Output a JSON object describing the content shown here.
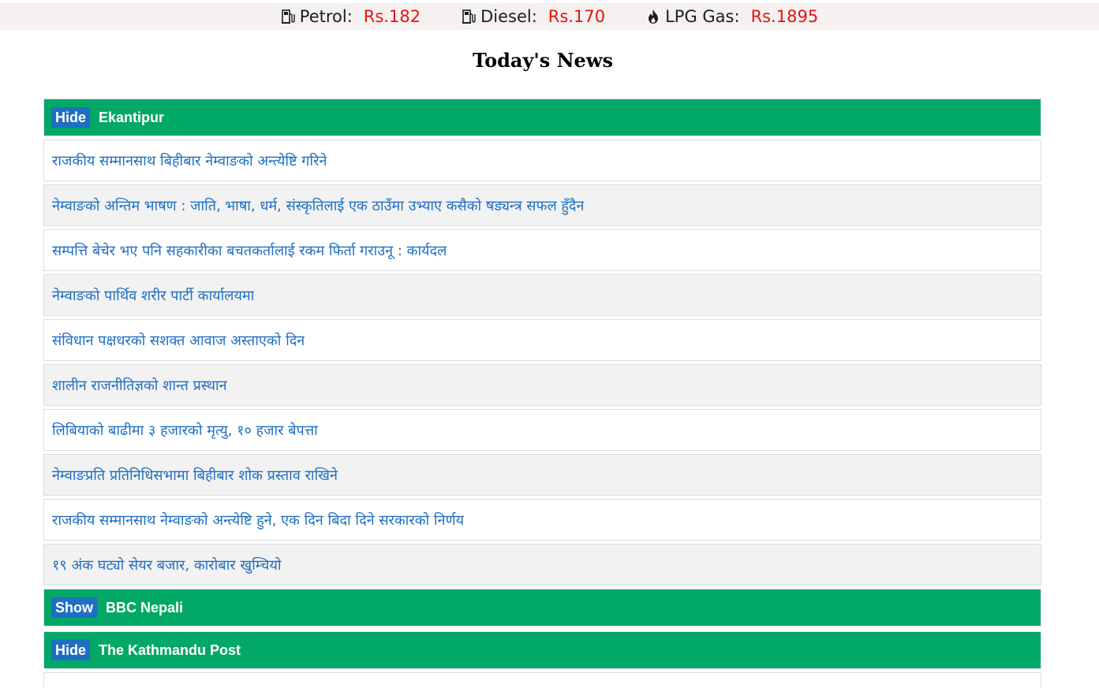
{
  "fuel_prices": [
    {
      "label": "Petrol:",
      "price": "Rs.182",
      "icon": "fuel-pump-icon"
    },
    {
      "label": "Diesel:",
      "price": "Rs.170",
      "icon": "fuel-pump-icon"
    },
    {
      "label": "LPG Gas:",
      "price": "Rs.1895",
      "icon": "flame-icon"
    }
  ],
  "page_title": "Today's News",
  "colors": {
    "header_green": "#02a866",
    "toggle_blue": "#1f6fc1",
    "link_blue": "#1f6fc1",
    "price_red": "#e31414"
  },
  "sources": [
    {
      "toggle": "Hide",
      "name": "Ekantipur",
      "expanded": true,
      "articles": [
        "राजकीय सम्मानसाथ बिहीबार नेम्वाङको अन्त्येष्टि गरिने",
        "नेम्वाङको अन्तिम भाषण : जाति, भाषा, धर्म, संस्कृतिलाई एक ठाउँमा उभ्याए कसैको षड्यन्त्र सफल हुँदैन",
        "सम्पत्ति बेचेर भए पनि सहकारीका बचतकर्तालाई रकम फिर्ता गराउनू : कार्यदल",
        "नेम्वाङको पार्थिव शरीर पार्टी कार्यालयमा",
        "संविधान पक्षधरको सशक्त आवाज अस्ताएको दिन",
        "शालीन राजनीतिज्ञको शान्त प्रस्थान",
        "लिबियाको बाढीमा ३ हजारको मृत्यु, १० हजार बेपत्ता",
        "नेम्वाङप्रति प्रतिनिधिसभामा बिहीबार शोक प्रस्ताव राखिने",
        "राजकीय सम्मानसाथ नेम्वाङको अन्त्येष्टि हुने, एक दिन बिदा दिने सरकारको निर्णय",
        "१९ अंक घट्यो सेयर बजार, कारोबार खुम्चियो"
      ]
    },
    {
      "toggle": "Show",
      "name": "BBC Nepali",
      "expanded": false,
      "articles": []
    },
    {
      "toggle": "Hide",
      "name": "The Kathmandu Post",
      "expanded": true,
      "articles": []
    }
  ]
}
